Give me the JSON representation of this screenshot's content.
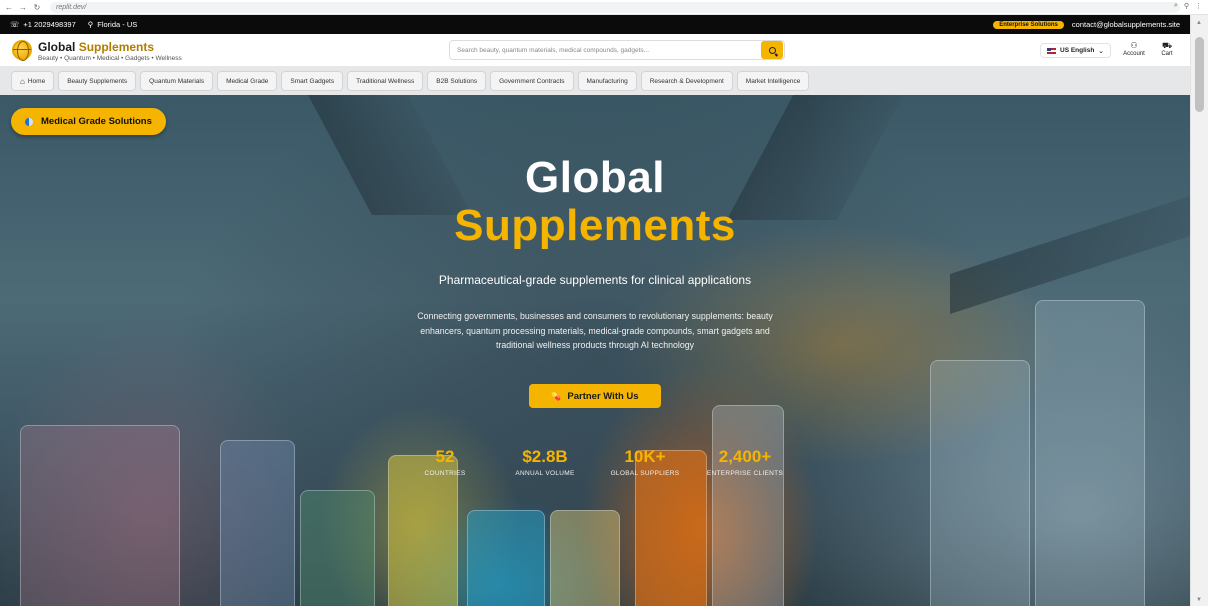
{
  "browser": {
    "url": "replit.dev/"
  },
  "topbar": {
    "phone": "+1 2029498397",
    "location": "Florida - US",
    "badge": "Enterprise Solutions",
    "email": "contact@globalsupplements.site"
  },
  "header": {
    "brand_main": "Global",
    "brand_accent": "Supplements",
    "tagline": "Beauty • Quantum • Medical • Gadgets • Wellness",
    "search_placeholder": "Search beauty, quantum materials, medical compounds, gadgets...",
    "language": "US English",
    "account_label": "Account",
    "cart_label": "Cart"
  },
  "nav": {
    "items": [
      "Home",
      "Beauty Supplements",
      "Quantum Materials",
      "Medical Grade",
      "Smart Gadgets",
      "Traditional Wellness",
      "B2B Solutions",
      "Government Contracts",
      "Manufacturing",
      "Research & Development",
      "Market Intelligence"
    ]
  },
  "hero": {
    "badge": "Medical Grade Solutions",
    "title_line1": "Global",
    "title_line2": "Supplements",
    "subtitle": "Pharmaceutical-grade supplements for clinical applications",
    "description": "Connecting governments, businesses and consumers to revolutionary supplements: beauty enhancers, quantum processing materials, medical-grade compounds, smart gadgets and traditional wellness products through AI technology",
    "cta_label": "Partner With Us",
    "stats": [
      {
        "value": "52",
        "label": "COUNTRIES"
      },
      {
        "value": "$2.8B",
        "label": "ANNUAL VOLUME"
      },
      {
        "value": "10K+",
        "label": "GLOBAL SUPPLIERS"
      },
      {
        "value": "2,400+",
        "label": "ENTERPRISE CLIENTS"
      }
    ]
  },
  "colors": {
    "accent": "#f5b400",
    "topbar_bg": "#0b0b0b",
    "nav_bg": "#e6e7e9"
  },
  "icons": {
    "phone": "phone-icon",
    "location": "location-pin-icon",
    "search": "search-icon",
    "account": "user-icon",
    "cart": "cart-icon",
    "home": "home-icon"
  }
}
